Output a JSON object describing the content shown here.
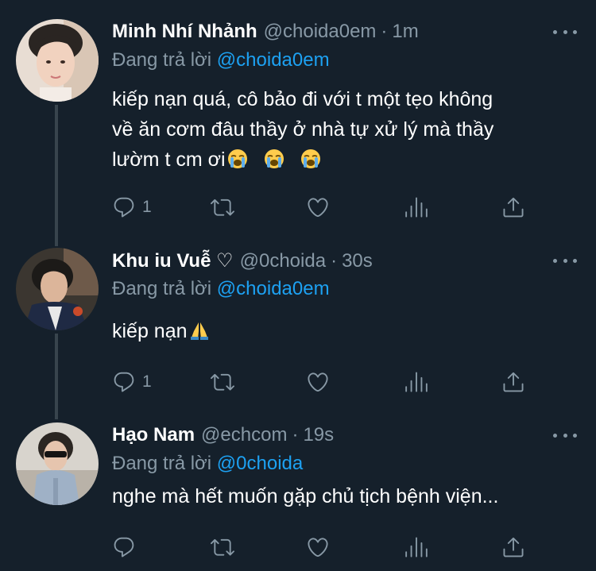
{
  "tweets": [
    {
      "name": "Minh Nhí Nhảnh",
      "handle": "@choida0em",
      "dot": "·",
      "time": "1m",
      "reply_prefix": "Đang trả lời ",
      "reply_to": "@choida0em",
      "text_line1": "kiếp nạn quá, cô bảo đi với t một tẹo không",
      "text_line2": "về ăn cơm đâu thầy ở nhà tự xử lý mà thầy",
      "text_line3": "lườm t cm ơi",
      "reply_count": "1"
    },
    {
      "name": "Khu iu Vuễ ♡",
      "handle": "@0choida",
      "dot": "·",
      "time": "30s",
      "reply_prefix": "Đang trả lời ",
      "reply_to": "@choida0em",
      "text": "kiếp nạn",
      "reply_count": "1"
    },
    {
      "name": "Hạo Nam",
      "handle": "@echcom",
      "dot": "·",
      "time": "19s",
      "reply_prefix": "Đang trả lời ",
      "reply_to": "@0choida",
      "text": "nghe mà hết muốn gặp chủ tịch bệnh viện...",
      "reply_count": ""
    }
  ],
  "colors": {
    "background": "#15202b",
    "secondary_text": "#8899a6",
    "mention": "#1da1f2",
    "thread_line": "#38444d"
  },
  "icons": [
    "reply-icon",
    "retweet-icon",
    "like-icon",
    "analytics-icon",
    "share-icon",
    "more-icon",
    "loudly-crying-face-emoji",
    "folded-hands-emoji"
  ]
}
